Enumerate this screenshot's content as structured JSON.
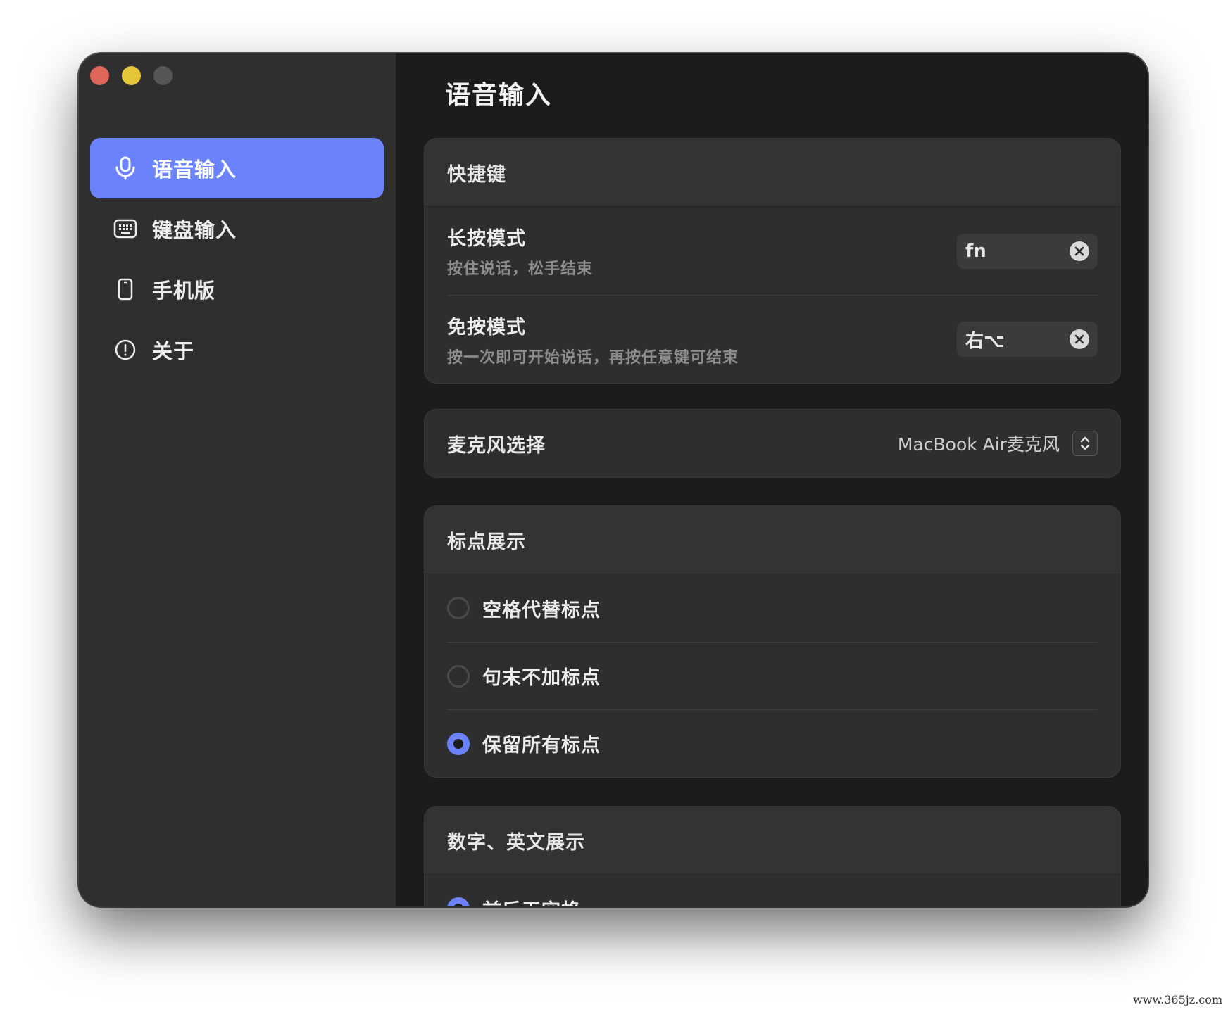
{
  "window": {
    "traffic_lights": [
      "close",
      "minimize",
      "zoom"
    ]
  },
  "sidebar": {
    "items": [
      {
        "label": "语音输入",
        "icon": "microphone-icon",
        "active": true
      },
      {
        "label": "键盘输入",
        "icon": "keyboard-icon",
        "active": false
      },
      {
        "label": "手机版",
        "icon": "phone-icon",
        "active": false
      },
      {
        "label": "关于",
        "icon": "info-icon",
        "active": false
      }
    ]
  },
  "main": {
    "title": "语音输入",
    "shortcuts": {
      "header": "快捷键",
      "rows": [
        {
          "title": "长按模式",
          "subtitle": "按住说话，松手结束",
          "key": "fn"
        },
        {
          "title": "免按模式",
          "subtitle": "按一次即可开始说话，再按任意键可结束",
          "key": "右⌥"
        }
      ]
    },
    "microphone": {
      "label": "麦克风选择",
      "value": "MacBook Air麦克风"
    },
    "punctuation": {
      "header": "标点展示",
      "options": [
        {
          "label": "空格代替标点",
          "checked": false
        },
        {
          "label": "句末不加标点",
          "checked": false
        },
        {
          "label": "保留所有标点",
          "checked": true
        }
      ]
    },
    "numbers_english": {
      "header": "数字、英文展示",
      "options": [
        {
          "label": "前后无空格",
          "checked": true
        }
      ]
    }
  },
  "colors": {
    "accent": "#6a82fb",
    "sidebar_bg": "#2f2f2f",
    "content_bg": "#1c1c1c",
    "card_bg": "#2e2e2e"
  },
  "watermark": "www.365jz.com"
}
